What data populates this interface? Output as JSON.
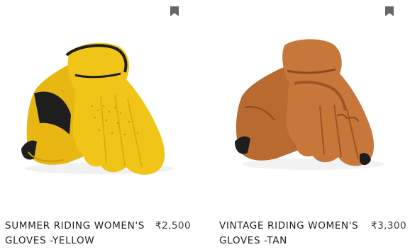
{
  "products": [
    {
      "name": "SUMMER RIDING WOMEN'S GLOVES -YELLOW",
      "price": "₹2,500",
      "image_icon": "yellow-glove-pair-icon",
      "bookmark_icon": "bookmark-icon",
      "colors": {
        "primary": "#f1c418",
        "shadow": "#d9a90e",
        "accent": "#1d1d1d"
      }
    },
    {
      "name": "VINTAGE RIDING WOMEN'S GLOVES -TAN",
      "price": "₹3,300",
      "image_icon": "tan-glove-pair-icon",
      "bookmark_icon": "bookmark-icon",
      "colors": {
        "primary": "#c7773a",
        "shadow": "#9e5424",
        "accent": "#1d1d1d"
      }
    }
  ],
  "colors": {
    "bookmark": "#666666",
    "text": "#1f1f1f"
  }
}
